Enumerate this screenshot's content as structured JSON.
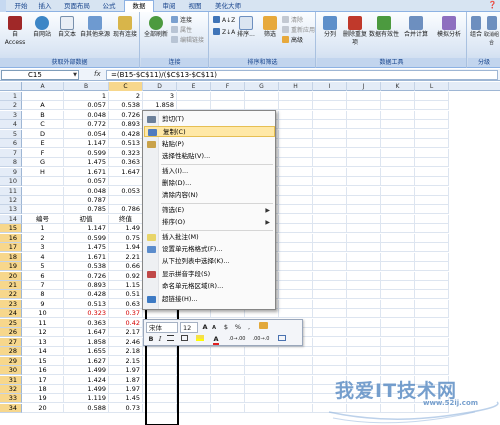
{
  "tabs": [
    "开始",
    "插入",
    "页面布局",
    "公式",
    "数据",
    "审阅",
    "视图",
    "美化大师"
  ],
  "active_tab": "数据",
  "ribbon": {
    "get_external": {
      "title": "获取外部数据",
      "buttons": [
        "自 Access",
        "自网站",
        "自文本",
        "自其他来源",
        "现有连接"
      ]
    },
    "connections": {
      "title": "连接",
      "big": "全部刷新",
      "small": [
        "连接",
        "属性",
        "编辑链接"
      ]
    },
    "sort_filter": {
      "title": "排序和筛选",
      "sort_small": [
        "A↓Z",
        "Z↓A"
      ],
      "sort": "排序...",
      "filter": "筛选",
      "small": [
        "清除",
        "重新应用",
        "高级"
      ]
    },
    "tools": {
      "title": "数据工具",
      "buttons": [
        "分列",
        "删除重复项",
        "数据有效性",
        "合并计算",
        "模拟分析"
      ]
    },
    "outline": {
      "title": "分级",
      "buttons": [
        "组合",
        "取消组合",
        "分类"
      ]
    }
  },
  "formula_bar": {
    "name_box": "C15",
    "fx": "fx",
    "formula": "=(B15-$C$11)/($C$13-$C$11)"
  },
  "columns": [
    "A",
    "B",
    "C",
    "D",
    "E",
    "F",
    "G",
    "H",
    "I",
    "J",
    "K",
    "L"
  ],
  "selected_column": "C",
  "rows": [
    {
      "n": "1",
      "a": "",
      "b": "1",
      "c": "2",
      "d": "3"
    },
    {
      "n": "2",
      "a": "A",
      "b": "0.057",
      "c": "0.538",
      "d": "1.858"
    },
    {
      "n": "3",
      "a": "B",
      "b": "0.048",
      "c": "0.726",
      "d": ""
    },
    {
      "n": "4",
      "a": "C",
      "b": "0.772",
      "c": "0.893",
      "d": ""
    },
    {
      "n": "5",
      "a": "D",
      "b": "0.054",
      "c": "0.428",
      "d": ""
    },
    {
      "n": "6",
      "a": "E",
      "b": "1.147",
      "c": "0.513",
      "d": ""
    },
    {
      "n": "7",
      "a": "F",
      "b": "0.599",
      "c": "0.323",
      "d": ""
    },
    {
      "n": "8",
      "a": "G",
      "b": "1.475",
      "c": "0.363",
      "d": ""
    },
    {
      "n": "9",
      "a": "H",
      "b": "1.671",
      "c": "1.647",
      "d": ""
    },
    {
      "n": "10",
      "a": "",
      "b": "0.057",
      "c": "",
      "d": ""
    },
    {
      "n": "11",
      "a": "",
      "b": "0.048",
      "c": "0.053",
      "d": ""
    },
    {
      "n": "12",
      "a": "",
      "b": "0.787",
      "c": "",
      "d": ""
    },
    {
      "n": "13",
      "a": "",
      "b": "0.785",
      "c": "0.786",
      "d": ""
    },
    {
      "n": "14",
      "a": "编号",
      "b": "初值",
      "c": "终值",
      "d": ""
    },
    {
      "n": "15",
      "a": "1",
      "b": "1.147",
      "c": "1.49",
      "d": ""
    },
    {
      "n": "16",
      "a": "2",
      "b": "0.599",
      "c": "0.75",
      "d": ""
    },
    {
      "n": "17",
      "a": "3",
      "b": "1.475",
      "c": "1.94",
      "d": ""
    },
    {
      "n": "18",
      "a": "4",
      "b": "1.671",
      "c": "2.21",
      "d": ""
    },
    {
      "n": "19",
      "a": "5",
      "b": "0.538",
      "c": "0.66",
      "d": ""
    },
    {
      "n": "20",
      "a": "6",
      "b": "0.726",
      "c": "0.92",
      "d": ""
    },
    {
      "n": "21",
      "a": "7",
      "b": "0.893",
      "c": "1.15",
      "d": ""
    },
    {
      "n": "22",
      "a": "8",
      "b": "0.428",
      "c": "0.51",
      "d": ""
    },
    {
      "n": "23",
      "a": "9",
      "b": "0.513",
      "c": "0.63",
      "d": ""
    },
    {
      "n": "24",
      "a": "10",
      "b": "0.323",
      "c": "0.37",
      "d": ""
    },
    {
      "n": "25",
      "a": "11",
      "b": "0.363",
      "c": "0.42",
      "d": ""
    },
    {
      "n": "26",
      "a": "12",
      "b": "1.647",
      "c": "2.17",
      "d": ""
    },
    {
      "n": "27",
      "a": "13",
      "b": "1.858",
      "c": "2.46",
      "d": ""
    },
    {
      "n": "28",
      "a": "14",
      "b": "1.655",
      "c": "2.18",
      "d": ""
    },
    {
      "n": "29",
      "a": "15",
      "b": "1.627",
      "c": "2.15",
      "d": ""
    },
    {
      "n": "30",
      "a": "16",
      "b": "1.499",
      "c": "1.97",
      "d": ""
    },
    {
      "n": "31",
      "a": "17",
      "b": "1.424",
      "c": "1.87",
      "d": ""
    },
    {
      "n": "32",
      "a": "18",
      "b": "1.499",
      "c": "1.97",
      "d": ""
    },
    {
      "n": "33",
      "a": "19",
      "b": "1.119",
      "c": "1.45",
      "d": ""
    },
    {
      "n": "34",
      "a": "20",
      "b": "0.588",
      "c": "0.73",
      "d": ""
    }
  ],
  "context_menu": [
    {
      "label": "剪切(T)",
      "icon": "scissors-icon",
      "sep_after": false,
      "arrow": false
    },
    {
      "label": "复制(C)",
      "icon": "copy-icon",
      "sep_after": false,
      "arrow": false,
      "hover": true
    },
    {
      "label": "粘贴(P)",
      "icon": "paste-icon",
      "sep_after": false,
      "arrow": false
    },
    {
      "label": "选择性粘贴(V)...",
      "icon": "",
      "sep_after": true,
      "arrow": false
    },
    {
      "label": "插入(I)...",
      "icon": "",
      "sep_after": false,
      "arrow": false
    },
    {
      "label": "删除(D)...",
      "icon": "",
      "sep_after": false,
      "arrow": false
    },
    {
      "label": "清除内容(N)",
      "icon": "",
      "sep_after": true,
      "arrow": false
    },
    {
      "label": "筛选(E)",
      "icon": "",
      "sep_after": false,
      "arrow": true
    },
    {
      "label": "排序(O)",
      "icon": "",
      "sep_after": true,
      "arrow": true
    },
    {
      "label": "插入批注(M)",
      "icon": "comment-icon",
      "sep_after": false,
      "arrow": false
    },
    {
      "label": "设置单元格格式(F)...",
      "icon": "format-cells-icon",
      "sep_after": false,
      "arrow": false
    },
    {
      "label": "从下拉列表中选择(K)...",
      "icon": "",
      "sep_after": false,
      "arrow": false
    },
    {
      "label": "显示拼音字段(S)",
      "icon": "phonetic-icon",
      "sep_after": false,
      "arrow": false
    },
    {
      "label": "命名单元格区域(R)...",
      "icon": "",
      "sep_after": false,
      "arrow": false
    },
    {
      "label": "超链接(H)...",
      "icon": "hyperlink-icon",
      "sep_after": false,
      "arrow": false
    }
  ],
  "mini_toolbar": {
    "font": "宋体",
    "size": "12",
    "grow": "A",
    "shrink": "A",
    "currency": "$",
    "percent": "%",
    "comma": ",",
    "bold": "B",
    "italic": "I",
    "inc_decimal": ".0→.00",
    "dec_decimal": ".00→.0"
  },
  "watermark": {
    "text": "我爱IT技术网",
    "url": "www.52ij.com"
  },
  "colors": {
    "selected_header": "#f7d78c",
    "menu_hover": "#ffe8a6",
    "ribbon_text": "#15428b",
    "red_value": "#d40000",
    "watermark": "#5f8fc5"
  }
}
